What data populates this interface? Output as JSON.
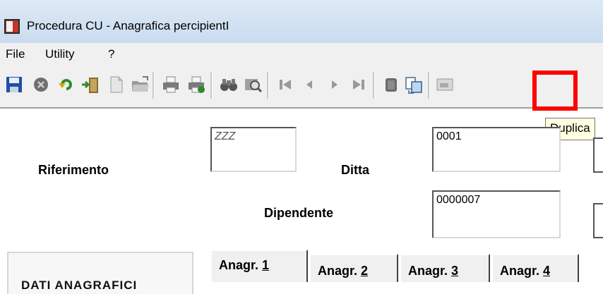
{
  "window": {
    "title": "Procedura CU - Anagrafica percipientI"
  },
  "menu": [
    {
      "label": "File"
    },
    {
      "label": "Utility"
    },
    {
      "label": "?"
    }
  ],
  "toolbar": {
    "buttons": [
      {
        "icon": "save-icon"
      },
      {
        "icon": "cancel-icon"
      },
      {
        "icon": "refresh-icon"
      },
      {
        "icon": "exit-door-icon"
      },
      {
        "icon": "new-document-icon"
      },
      {
        "icon": "open-folder-icon"
      },
      {
        "icon": "print-icon"
      },
      {
        "icon": "print-preview-icon"
      },
      {
        "icon": "find-binoculars-icon"
      },
      {
        "icon": "search-folder-icon"
      },
      {
        "icon": "first-record-icon"
      },
      {
        "icon": "previous-record-icon"
      },
      {
        "icon": "next-record-icon"
      },
      {
        "icon": "last-record-icon"
      },
      {
        "icon": "delete-icon"
      },
      {
        "icon": "duplicate-icon"
      },
      {
        "icon": "other-tool-icon"
      }
    ],
    "tooltip": "Duplica",
    "highlight_color": "#ff0000"
  },
  "form": {
    "riferimento_label": "Riferimento",
    "riferimento_value": "ZZZ",
    "ditta_label": "Ditta",
    "ditta_value": "0001",
    "dipendente_label": "Dipendente",
    "dipendente_value": "0000007"
  },
  "panel": {
    "title": "DATI ANAGRAFICI"
  },
  "tabs": [
    {
      "prefix": "Anagr. ",
      "num": "1"
    },
    {
      "prefix": "Anagr. ",
      "num": "2"
    },
    {
      "prefix": "Anagr. ",
      "num": "3"
    },
    {
      "prefix": "Anagr. ",
      "num": "4"
    }
  ]
}
